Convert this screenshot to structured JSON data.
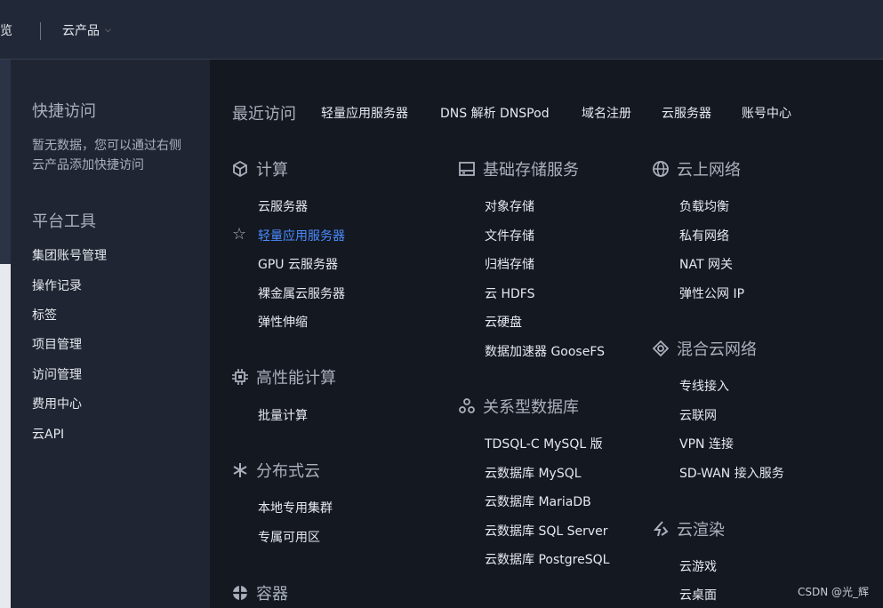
{
  "topbar": {
    "overview": "总览",
    "product": "云产品"
  },
  "sidebar": {
    "quick_access_title": "快捷访问",
    "quick_access_empty": "暂无数据，您可以通过右侧云产品添加快捷访问",
    "tools_title": "平台工具",
    "tools": [
      "集团账号管理",
      "操作记录",
      "标签",
      "项目管理",
      "访问管理",
      "费用中心",
      "云API"
    ]
  },
  "recent": {
    "label": "最近访问",
    "items": [
      "轻量应用服务器",
      "DNS 解析 DNSPod",
      "域名注册",
      "云服务器",
      "账号中心"
    ]
  },
  "categories": {
    "compute": {
      "title": "计算",
      "items": [
        "云服务器",
        "轻量应用服务器",
        "GPU 云服务器",
        "裸金属云服务器",
        "弹性伸缩"
      ]
    },
    "hpc": {
      "title": "高性能计算",
      "items": [
        "批量计算"
      ]
    },
    "distributed": {
      "title": "分布式云",
      "items": [
        "本地专用集群",
        "专属可用区"
      ]
    },
    "container": {
      "title": "容器"
    },
    "storage": {
      "title": "基础存储服务",
      "items": [
        "对象存储",
        "文件存储",
        "归档存储",
        "云 HDFS",
        "云硬盘",
        "数据加速器 GooseFS"
      ]
    },
    "database": {
      "title": "关系型数据库",
      "items": [
        "TDSQL-C MySQL 版",
        "云数据库 MySQL",
        "云数据库 MariaDB",
        "云数据库 SQL Server",
        "云数据库 PostgreSQL"
      ]
    },
    "network": {
      "title": "云上网络",
      "items": [
        "负载均衡",
        "私有网络",
        "NAT 网关",
        "弹性公网 IP"
      ]
    },
    "hybrid": {
      "title": "混合云网络",
      "items": [
        "专线接入",
        "云联网",
        "VPN 连接",
        "SD-WAN 接入服务"
      ]
    },
    "render": {
      "title": "云渲染",
      "items": [
        "云游戏",
        "云桌面"
      ]
    }
  },
  "watermark": "CSDN @光_辉",
  "colors": {
    "active_link": "#4a8cff",
    "panel_bg": "#141821",
    "sidebar_bg": "#1f2532",
    "topbar_bg": "#212938"
  }
}
